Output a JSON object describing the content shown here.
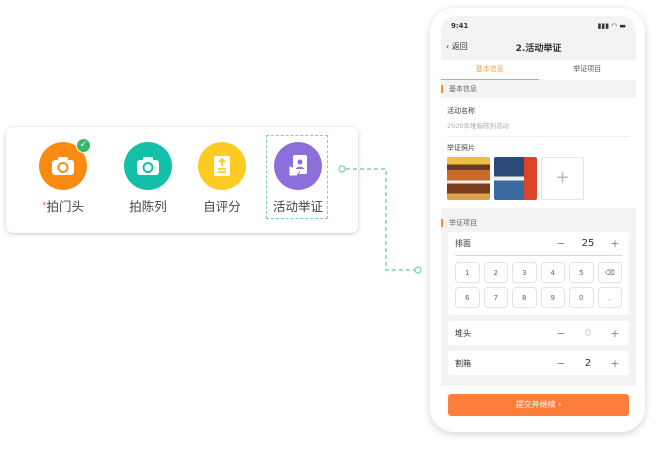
{
  "tiles": [
    {
      "label": "拍门头",
      "required": "*",
      "icon": "camera-icon",
      "color": "#fb8a13",
      "done": true
    },
    {
      "label": "拍陈列",
      "icon": "camera-icon",
      "color": "#13bfa9"
    },
    {
      "label": "自评分",
      "icon": "upload-doc-icon",
      "color": "#fccc22"
    },
    {
      "label": "活动举证",
      "icon": "phone-person-icon",
      "color": "#8d6fdc"
    }
  ],
  "phone": {
    "time": "9:41",
    "back": "返回",
    "title": "2.活动举证",
    "tabs": [
      "基本信息",
      "举证项目"
    ],
    "section1": "基本信息",
    "activity_label": "活动名称",
    "activity_value": "2020年堆箱陈列活动",
    "photos_label": "举证照片",
    "add": "+",
    "section2": "举证项目",
    "items": [
      {
        "name": "排面",
        "value": "25"
      },
      {
        "name": "堆头",
        "value": "0"
      },
      {
        "name": "割箱",
        "value": "2"
      }
    ],
    "minus": "−",
    "plus": "+",
    "keys": [
      "1",
      "2",
      "3",
      "4",
      "5",
      "⌫",
      "6",
      "7",
      "8",
      "9",
      "0",
      "."
    ],
    "submit": "提交并继续 ›"
  }
}
